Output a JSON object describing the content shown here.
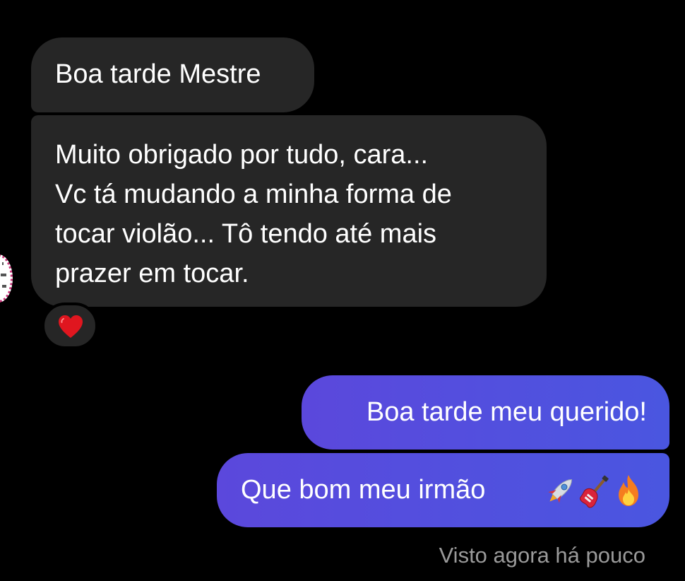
{
  "conversation": {
    "incoming": [
      {
        "lines": [
          "Boa tarde Mestre"
        ]
      },
      {
        "lines": [
          "Muito obrigado por tudo, cara...",
          "Vc tá mudando a minha forma de",
          "tocar violão... Tô tendo até mais",
          "prazer em tocar."
        ],
        "reaction": "heart-icon"
      }
    ],
    "outgoing": [
      {
        "text": "Boa tarde meu querido!"
      },
      {
        "text": "Que bom meu irmão",
        "emojis": [
          "rocket-icon",
          "electric-guitar-icon",
          "fire-icon"
        ]
      }
    ],
    "status": "Visto agora há pouco"
  },
  "colors": {
    "background": "#000000",
    "incoming_bubble": "#262626",
    "outgoing_bubble_start": "#5b48dc",
    "outgoing_bubble_end": "#4a56e0",
    "reaction_heart": "#e0161f",
    "status_text": "#9a9a9a"
  }
}
